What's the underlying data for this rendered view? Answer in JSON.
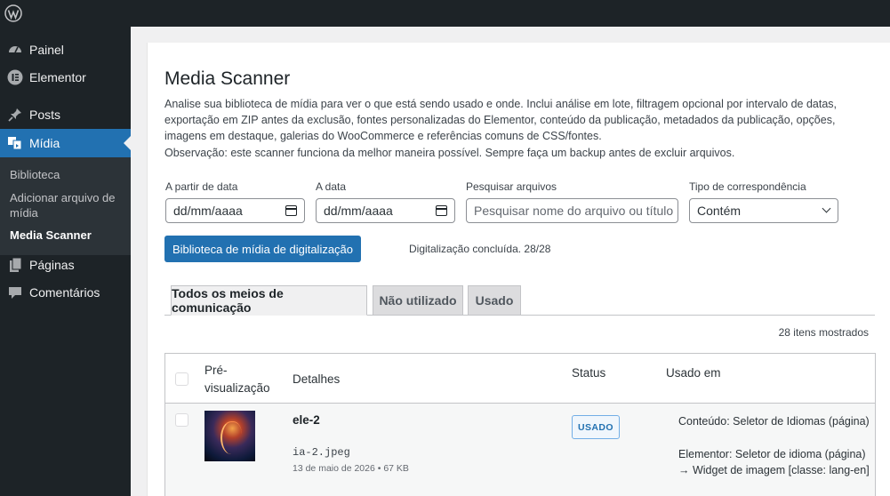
{
  "sidebar": {
    "items": [
      {
        "label": "Painel",
        "icon": "dashboard-icon"
      },
      {
        "label": "Elementor",
        "icon": "elementor-icon"
      },
      {
        "label": "Posts",
        "icon": "pin-icon"
      },
      {
        "label": "Mídia",
        "icon": "media-icon"
      },
      {
        "label": "Páginas",
        "icon": "pages-icon"
      },
      {
        "label": "Comentários",
        "icon": "comments-icon"
      }
    ],
    "submenu": [
      "Biblioteca",
      "Adicionar arquivo de mídia",
      "Media Scanner"
    ]
  },
  "page": {
    "title": "Media Scanner",
    "description": "Analise sua biblioteca de mídia para ver o que está sendo usado e onde. Inclui análise em lote, filtragem opcional por intervalo de datas, exportação em ZIP antes da exclusão, fontes personalizadas do Elementor, conteúdo da publicação, metadados da publicação, opções, imagens em destaque, galerias do WooCommerce e referências comuns de CSS/fontes.",
    "note": "Observação: este scanner funciona da melhor maneira possível. Sempre faça um backup antes de excluir arquivos."
  },
  "filters": {
    "from_label": "A partir de data",
    "from_value": "dd/mm/aaaa",
    "to_label": "A data",
    "to_value": "dd/mm/aaaa",
    "search_label": "Pesquisar arquivos",
    "search_placeholder": "Pesquisar nome do arquivo ou título",
    "match_label": "Tipo de correspondência",
    "match_value": "Contém"
  },
  "scan": {
    "button": "Biblioteca de mídia de digitalização",
    "status": "Digitalização concluída. 28/28"
  },
  "tabs": [
    "Todos os meios de comunicação",
    "Não utilizado",
    "Usado"
  ],
  "count": "28 itens mostrados",
  "table": {
    "headers": {
      "preview": "Pré-visualização",
      "details": "Detalhes",
      "status": "Status",
      "used_in": "Usado em"
    },
    "rows": [
      {
        "title": "ele-2",
        "filename": "ia-2.jpeg",
        "meta": "13 de maio de 2026 • 67 KB",
        "status": "USADO",
        "usage_1": "Conteúdo: Seletor de Idiomas (página)",
        "usage_2": "Elementor: Seletor de idioma (página) → Widget de imagem [classe: lang-en]"
      }
    ]
  }
}
